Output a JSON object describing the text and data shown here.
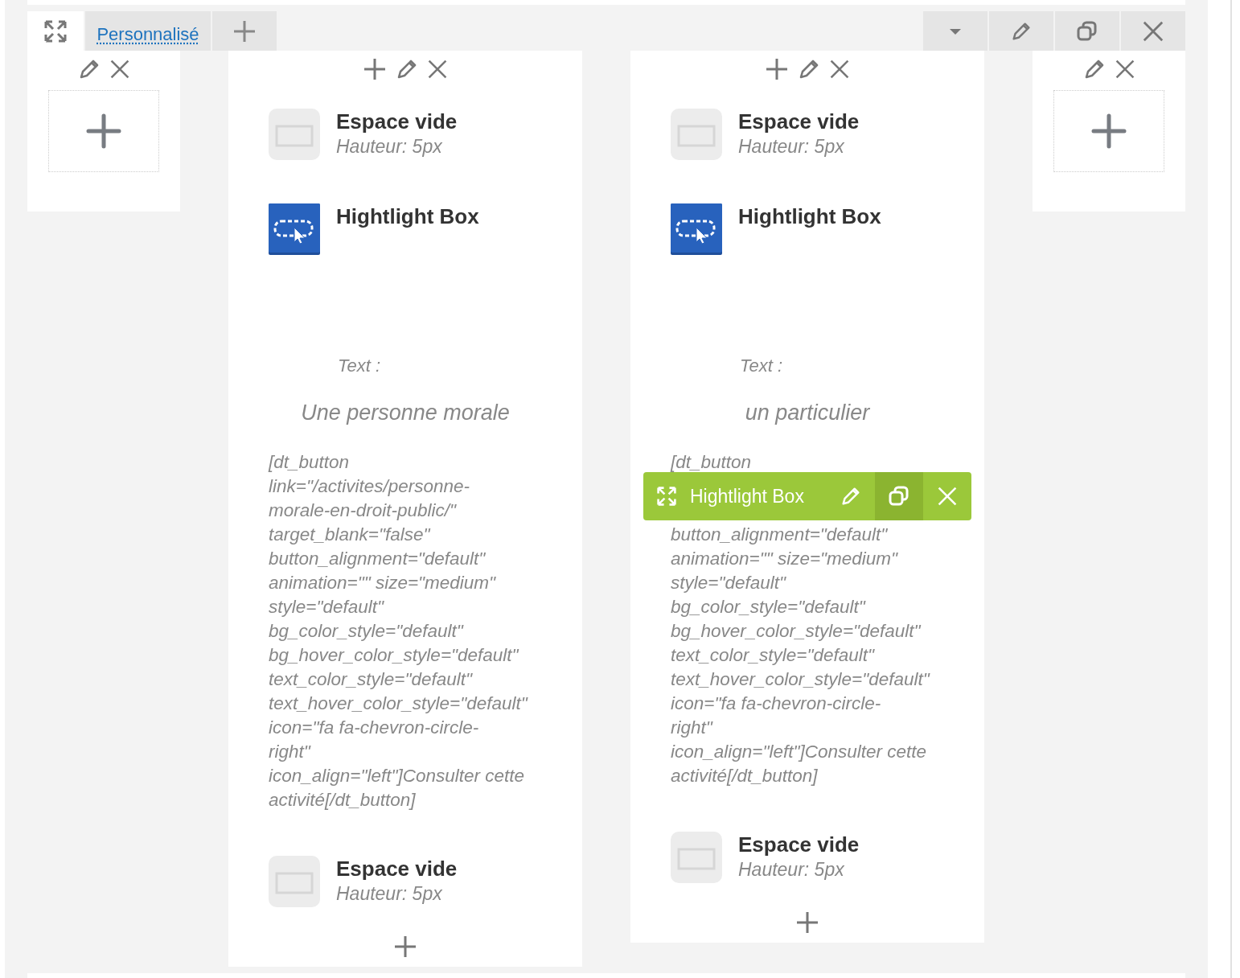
{
  "tab": {
    "label": "Personnalisé"
  },
  "columns": [
    {
      "kind": "empty"
    },
    {
      "kind": "content",
      "elements": [
        {
          "kind": "spacer",
          "title": "Espace vide",
          "subtitle": "Hauteur: 5px"
        },
        {
          "kind": "highlight",
          "title": "Hightlight Box",
          "text_label": "Text :",
          "text": "Une personne morale",
          "code": "[dt_button\nlink=\"/activites/personne-\nmorale-en-droit-public/\"\ntarget_blank=\"false\"\nbutton_alignment=\"default\"\nanimation=\"\" size=\"medium\"\nstyle=\"default\"\nbg_color_style=\"default\"\nbg_hover_color_style=\"default\"\ntext_color_style=\"default\"\ntext_hover_color_style=\"default\"\nicon=\"fa fa-chevron-circle-\nright\"\nicon_align=\"left\"]Consulter cette\nactivité[/dt_button]"
        },
        {
          "kind": "spacer",
          "title": "Espace vide",
          "subtitle": "Hauteur: 5px"
        }
      ]
    },
    {
      "kind": "content",
      "elements": [
        {
          "kind": "spacer",
          "title": "Espace vide",
          "subtitle": "Hauteur: 5px"
        },
        {
          "kind": "highlight",
          "title": "Hightlight Box",
          "text_label": "Text :",
          "text": "un particulier",
          "code": "[dt_button",
          "overlay": {
            "label": "Hightlight Box"
          },
          "code_after": "button_alignment=\"default\"\nanimation=\"\" size=\"medium\"\nstyle=\"default\"\nbg_color_style=\"default\"\nbg_hover_color_style=\"default\"\ntext_color_style=\"default\"\ntext_hover_color_style=\"default\"\nicon=\"fa fa-chevron-circle-\nright\"\nicon_align=\"left\"]Consulter cette\nactivité[/dt_button]"
        },
        {
          "kind": "spacer",
          "title": "Espace vide",
          "subtitle": "Hauteur: 5px"
        }
      ]
    },
    {
      "kind": "empty"
    }
  ]
}
